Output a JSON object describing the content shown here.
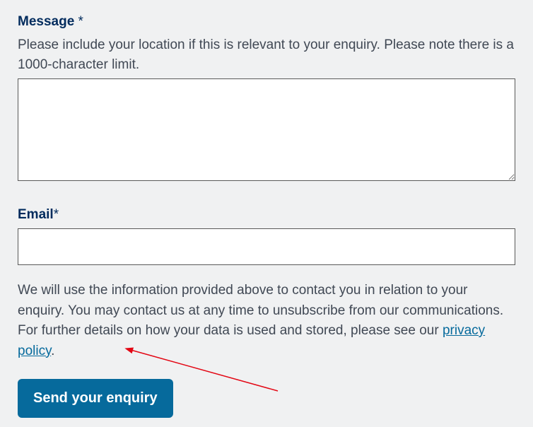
{
  "message": {
    "label": "Message",
    "required_marker": " *",
    "helper": "Please include your location if this is relevant to your enquiry. Please note there is a 1000-character limit.",
    "value": ""
  },
  "email": {
    "label": "Email",
    "required_marker": "*",
    "value": ""
  },
  "privacy": {
    "text_before": "We will use the information provided above to contact you in relation to your enquiry. You may contact us at any time to unsubscribe from our communications. For further details on how your data is used and stored, please see our ",
    "link_label": "privacy policy",
    "text_after": "."
  },
  "submit": {
    "label": "Send your enquiry"
  }
}
